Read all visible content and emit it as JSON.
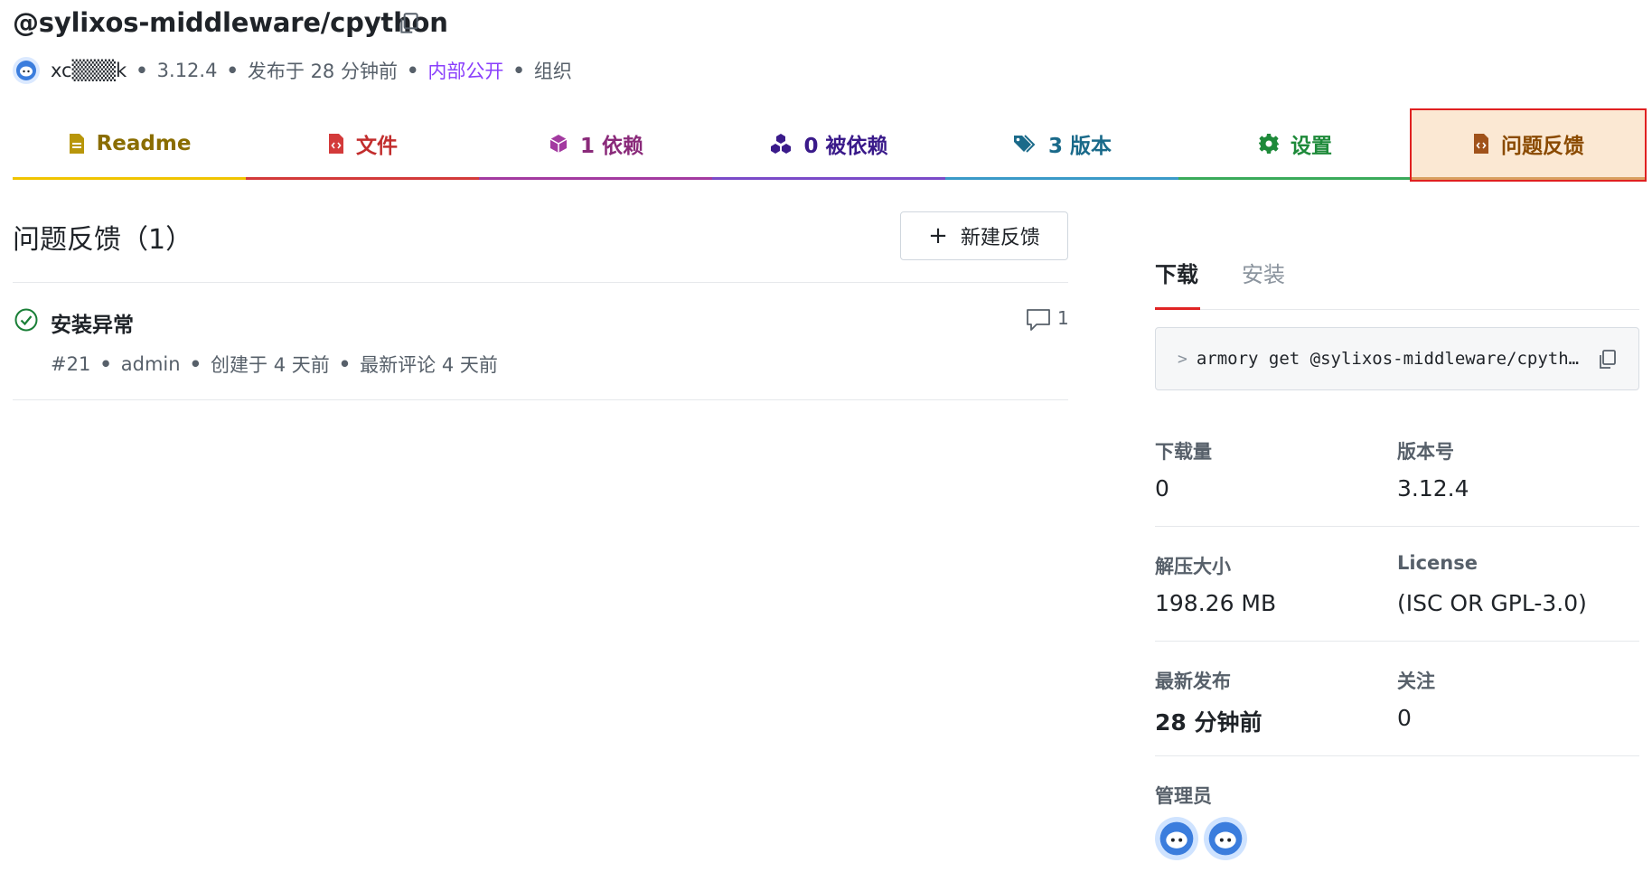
{
  "header": {
    "package_name": "@sylixos-middleware/cpython",
    "author": "xc▒▒▒k",
    "version": "3.12.4",
    "published": "发布于 28 分钟前",
    "visibility": "内部公开",
    "owner_type": "组织"
  },
  "tabs": [
    {
      "label": "Readme"
    },
    {
      "label": "文件"
    },
    {
      "label": "1 依赖"
    },
    {
      "label": "0 被依赖"
    },
    {
      "label": "3 版本"
    },
    {
      "label": "设置"
    },
    {
      "label": "问题反馈"
    }
  ],
  "issues": {
    "title": "问题反馈（1）",
    "new_button": "新建反馈",
    "items": [
      {
        "title": "安装异常",
        "number": "#21",
        "author": "admin",
        "created": "创建于 4 天前",
        "last_comment": "最新评论 4 天前",
        "comments": "1"
      }
    ]
  },
  "sidebar": {
    "tabs": {
      "download": "下载",
      "install": "安装"
    },
    "command": {
      "prompt": ">",
      "text": "armory get @sylixos-middleware/cpython"
    },
    "stats": {
      "downloads_label": "下载量",
      "downloads_value": "0",
      "version_label": "版本号",
      "version_value": "3.12.4",
      "size_label": "解压大小",
      "size_value": "198.26 MB",
      "license_label": "License",
      "license_value": "(ISC OR GPL-3.0)",
      "latest_label": "最新发布",
      "latest_value": "28 分钟前",
      "watch_label": "关注",
      "watch_value": "0",
      "admins_label": "管理员"
    }
  },
  "colors": {
    "accent_red": "#e02424",
    "visibility_purple": "#8a3ffc",
    "selected_tab_bg": "#fbe8d3",
    "success_green": "#1a7f37"
  }
}
